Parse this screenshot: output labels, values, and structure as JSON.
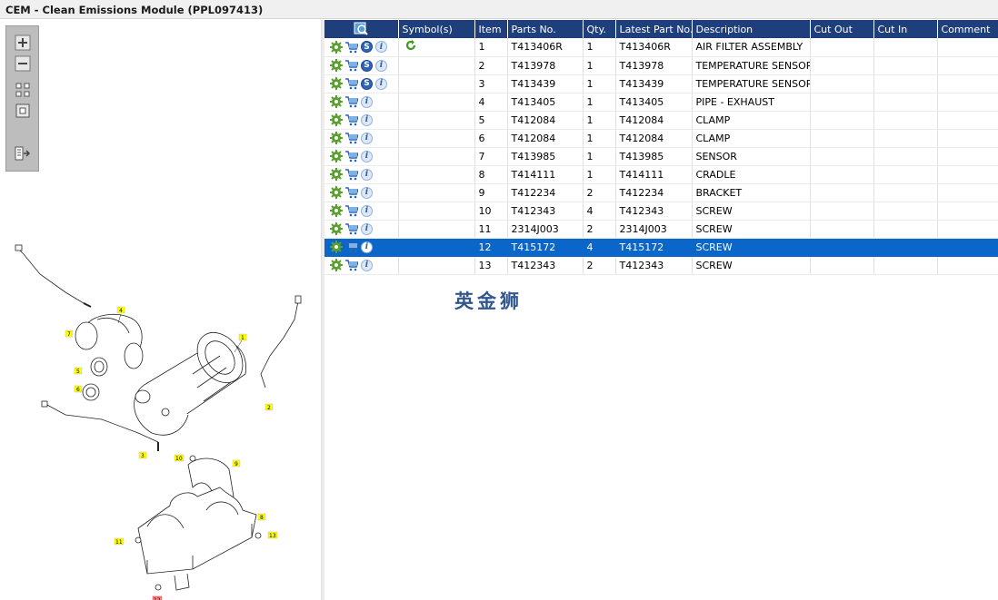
{
  "window": {
    "title": "CEM - Clean Emissions Module (PPL097413)"
  },
  "toolbar": {
    "buttons": [
      {
        "name": "zoom-in-icon"
      },
      {
        "name": "zoom-out-icon"
      },
      {
        "name": "fit-all-icon"
      },
      {
        "name": "fit-window-icon"
      },
      {
        "name": "export-icon"
      }
    ]
  },
  "drawing": {
    "callouts": [
      "1",
      "2",
      "3",
      "4",
      "5",
      "6",
      "7",
      "8",
      "9",
      "10",
      "11",
      "12",
      "13"
    ]
  },
  "table": {
    "headers": {
      "symbols": "Symbol(s)",
      "item": "Item",
      "parts_no": "Parts No.",
      "qty": "Qty.",
      "latest": "Latest Part No.",
      "description": "Description",
      "cut_out": "Cut Out",
      "cut_in": "Cut In",
      "comment": "Comment"
    },
    "rows": [
      {
        "item": "1",
        "part": "T413406R",
        "qty": "1",
        "latest": "T413406R",
        "desc": "AIR FILTER ASSEMBLY",
        "s": true,
        "symbol": "refresh"
      },
      {
        "item": "2",
        "part": "T413978",
        "qty": "1",
        "latest": "T413978",
        "desc": "TEMPERATURE SENSOR",
        "s": true
      },
      {
        "item": "3",
        "part": "T413439",
        "qty": "1",
        "latest": "T413439",
        "desc": "TEMPERATURE SENSOR",
        "s": true
      },
      {
        "item": "4",
        "part": "T413405",
        "qty": "1",
        "latest": "T413405",
        "desc": "PIPE - EXHAUST",
        "s": false
      },
      {
        "item": "5",
        "part": "T412084",
        "qty": "1",
        "latest": "T412084",
        "desc": "CLAMP",
        "s": false
      },
      {
        "item": "6",
        "part": "T412084",
        "qty": "1",
        "latest": "T412084",
        "desc": "CLAMP",
        "s": false
      },
      {
        "item": "7",
        "part": "T413985",
        "qty": "1",
        "latest": "T413985",
        "desc": "SENSOR",
        "s": false
      },
      {
        "item": "8",
        "part": "T414111",
        "qty": "1",
        "latest": "T414111",
        "desc": "CRADLE",
        "s": false
      },
      {
        "item": "9",
        "part": "T412234",
        "qty": "2",
        "latest": "T412234",
        "desc": "BRACKET",
        "s": false
      },
      {
        "item": "10",
        "part": "T412343",
        "qty": "4",
        "latest": "T412343",
        "desc": "SCREW",
        "s": false
      },
      {
        "item": "11",
        "part": "2314J003",
        "qty": "2",
        "latest": "2314J003",
        "desc": "SCREW",
        "s": false
      },
      {
        "item": "12",
        "part": "T415172",
        "qty": "4",
        "latest": "T415172",
        "desc": "SCREW",
        "s": false,
        "selected": true
      },
      {
        "item": "13",
        "part": "T412343",
        "qty": "2",
        "latest": "T412343",
        "desc": "SCREW",
        "s": false
      }
    ]
  },
  "watermark": "英金狮",
  "colors": {
    "header": "#1e3f7b",
    "selection": "#0a66c8",
    "callout": "#ffff00"
  }
}
